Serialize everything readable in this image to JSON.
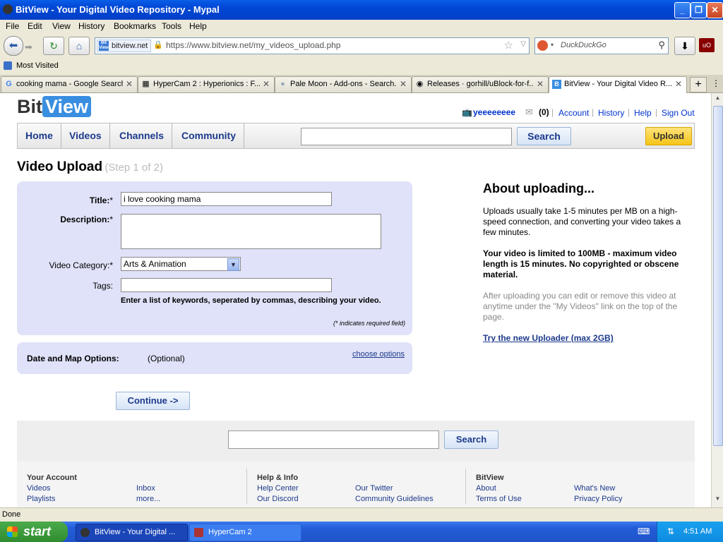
{
  "window": {
    "title": "BitView - Your Digital Video Repository - Mypal",
    "min": "_",
    "restore": "❐",
    "close": "✕"
  },
  "menu": [
    "File",
    "Edit",
    "View",
    "History",
    "Bookmarks",
    "Tools",
    "Help"
  ],
  "urlbar": {
    "identity": "bitview.net",
    "url": "https://www.bitview.net/my_videos_upload.php"
  },
  "search_engine": {
    "placeholder": "DuckDuckGo"
  },
  "bookmarks": {
    "most_visited": "Most Visited"
  },
  "tabs": [
    {
      "label": "cooking mama - Google Search",
      "icon": "G"
    },
    {
      "label": "HyperCam 2 : Hyperionics : F...",
      "icon": "▦"
    },
    {
      "label": "Pale Moon - Add-ons - Search...",
      "icon": "●"
    },
    {
      "label": "Releases · gorhill/uBlock-for-f...",
      "icon": "◉"
    },
    {
      "label": "BitView - Your Digital Video R...",
      "icon": "B"
    }
  ],
  "site": {
    "logo_bit": "Bit",
    "logo_view": "View",
    "username": "yeeeeeeee",
    "messages_count": "(0)",
    "links": [
      "Account",
      "History",
      "Help",
      "Sign Out"
    ],
    "nav": [
      "Home",
      "Videos",
      "Channels",
      "Community"
    ],
    "search_button": "Search",
    "upload_button": "Upload"
  },
  "upload": {
    "heading": "Video Upload",
    "step": "(Step 1 of 2)",
    "title_label": "Title:",
    "title_value": "i love cooking mama",
    "description_label": "Description:",
    "category_label": "Video Category:",
    "category_value": "Arts & Animation",
    "tags_label": "Tags:",
    "tags_help": "Enter a list of keywords, seperated by commas, describing your video.",
    "required_note": "(* indicates required field)",
    "date_map_label": "Date and Map Options:",
    "optional": "(Optional)",
    "choose_options": "choose options",
    "continue_button": "Continue ->"
  },
  "about": {
    "heading": "About uploading...",
    "p1": "Uploads usually take 1-5 minutes per MB on a high-speed connection, and converting your video takes a few minutes.",
    "p2": "Your video is limited to 100MB - maximum video length is 15 minutes. No copyrighted or obscene material.",
    "p3": "After uploading you can edit or remove this video at anytime under the \"My Videos\" link on the top of the page.",
    "new_uploader": "Try the new Uploader (max 2GB)"
  },
  "footer": {
    "search_button": "Search",
    "your_account": {
      "heading": "Your Account",
      "links": [
        "Videos",
        "Inbox",
        "Playlists",
        "more..."
      ]
    },
    "help_info": {
      "heading": "Help & Info",
      "links": [
        "Help Center",
        "Our Twitter",
        "Our Discord",
        "Community Guidelines"
      ]
    },
    "bitview": {
      "heading": "BitView",
      "links": [
        "About",
        "What's New",
        "Terms of Use",
        "Privacy Policy"
      ]
    }
  },
  "status": "Done",
  "taskbar": {
    "start": "start",
    "items": [
      "BitView - Your Digital ...",
      "HyperCam 2"
    ],
    "clock": "4:51 AM"
  }
}
